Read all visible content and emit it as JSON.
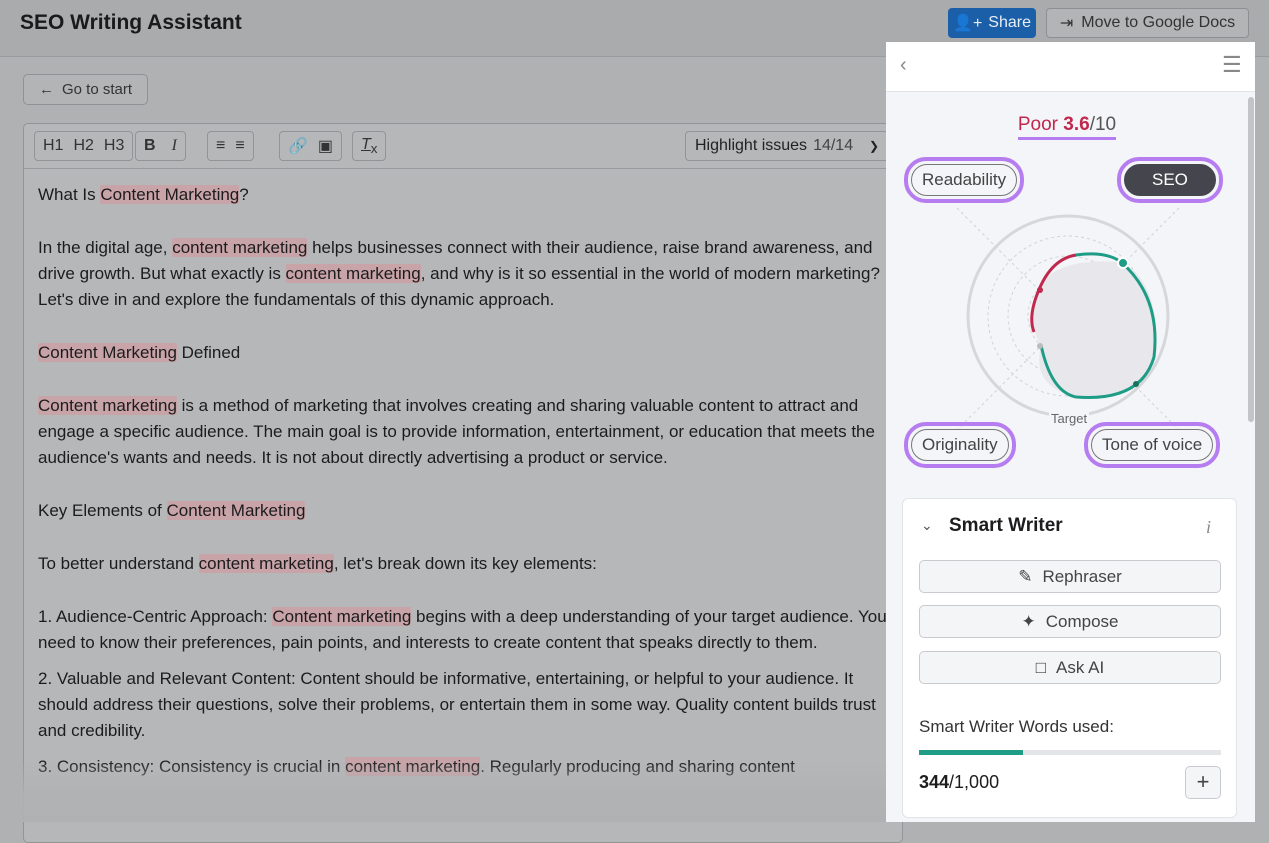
{
  "header": {
    "title": "SEO Writing Assistant",
    "share_label": "Share",
    "gdocs_label": "Move to Google Docs"
  },
  "go_to_start": "Go to start",
  "toolbar": {
    "h1": "H1",
    "h2": "H2",
    "h3": "H3",
    "bold": "B",
    "italic": "I",
    "highlight_label": "Highlight issues",
    "highlight_count": "14/14"
  },
  "content": [
    {
      "type": "p",
      "segments": [
        {
          "t": "What Is "
        },
        {
          "t": "Content Marketing",
          "hl": true
        },
        {
          "t": "?"
        }
      ]
    },
    {
      "type": "p",
      "segments": [
        {
          "t": "In the digital age, "
        },
        {
          "t": "content marketing",
          "hl": true
        },
        {
          "t": " helps businesses connect with their audience, raise brand awareness, and drive growth. But what exactly is "
        },
        {
          "t": "content marketing",
          "hl": true
        },
        {
          "t": ", and why is it so essential in the world of modern marketing? Let's dive in and explore the fundamentals of this dynamic approach."
        }
      ]
    },
    {
      "type": "p",
      "segments": [
        {
          "t": "Content Marketing",
          "hl": true
        },
        {
          "t": " Defined"
        }
      ]
    },
    {
      "type": "p",
      "segments": [
        {
          "t": "Content marketing",
          "hl": true
        },
        {
          "t": " is a method of marketing that involves creating and sharing valuable content to attract and engage a specific audience. The main goal is to provide information, entertainment, or education that meets the audience's wants and needs. It is not about directly advertising a product or service."
        }
      ]
    },
    {
      "type": "p",
      "segments": [
        {
          "t": "Key Elements of "
        },
        {
          "t": "Content Marketing",
          "hl": true
        }
      ]
    },
    {
      "type": "p",
      "segments": [
        {
          "t": "To better understand "
        },
        {
          "t": "content marketing",
          "hl": true
        },
        {
          "t": ", let's break down its key elements:"
        }
      ]
    },
    {
      "type": "li",
      "segments": [
        {
          "t": "1. Audience-Centric Approach: "
        },
        {
          "t": "Content marketing",
          "hl": true
        },
        {
          "t": " begins with a deep understanding of your target audience. You need to know their preferences, pain points, and interests to create content that speaks directly to them."
        }
      ]
    },
    {
      "type": "li",
      "segments": [
        {
          "t": "2. Valuable and Relevant Content: Content should be informative, entertaining, or helpful to your audience. It should address their questions, solve their problems, or entertain them in some way. Quality content builds trust and credibility."
        }
      ]
    },
    {
      "type": "li",
      "segments": [
        {
          "t": "3. Consistency: Consistency is crucial in "
        },
        {
          "t": "content marketing",
          "hl": true
        },
        {
          "t": ". Regularly producing and sharing content"
        }
      ]
    }
  ],
  "panel": {
    "score_label": "Poor",
    "score_value": "3.6",
    "score_max": "/10",
    "score_color": "#c0284e",
    "tabs": [
      {
        "label": "Readability",
        "selected": false
      },
      {
        "label": "SEO",
        "selected": true
      },
      {
        "label": "Originality",
        "selected": false
      },
      {
        "label": "Tone of voice",
        "selected": false
      }
    ],
    "target_label": "Target",
    "smart_writer": {
      "title": "Smart Writer",
      "buttons": [
        "Rephraser",
        "Compose",
        "Ask AI"
      ],
      "words_label": "Smart Writer Words used:",
      "used": "344",
      "total": "/1,000",
      "used_fraction": 0.344,
      "accent": "#1f9c85"
    }
  }
}
